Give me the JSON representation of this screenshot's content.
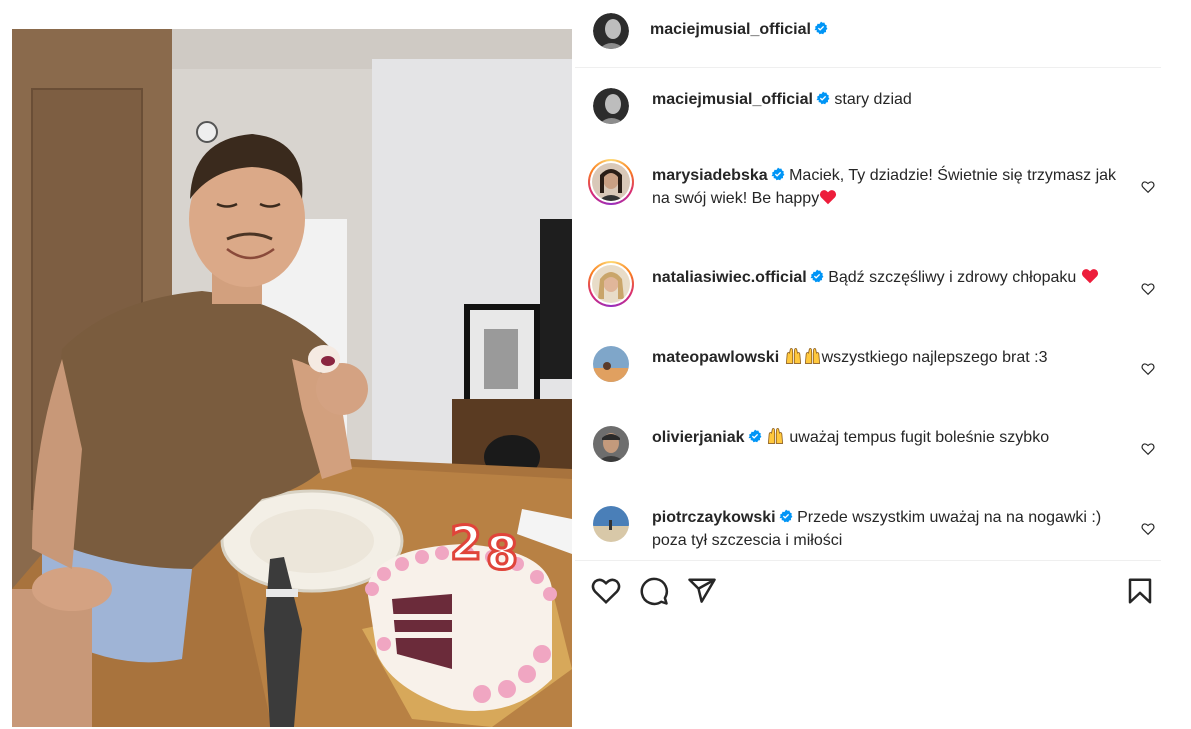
{
  "post": {
    "author": "maciejmusial_official",
    "caption_author": "maciejmusial_official",
    "caption_text": "stary dziad"
  },
  "comments": [
    {
      "username": "marysiadebska",
      "verified": true,
      "text": "Maciek, Ty dziadzie! Świetnie się trzymasz jak na swój wiek! Be happy",
      "emoji": "red-heart"
    },
    {
      "username": "nataliasiwiec.official",
      "verified": true,
      "text": "Bądź szczęśliwy i zdrowy chłopaku ",
      "emoji": "red-heart"
    },
    {
      "username": "mateopawlowski",
      "verified": false,
      "text": "wszystkiego najlepszego brat :3",
      "emoji": "raising-hands"
    },
    {
      "username": "olivierjaniak",
      "verified": true,
      "text": " uważaj tempus fugit boleśnie szybko",
      "emoji": "raising-hands"
    },
    {
      "username": "piotrczaykowski",
      "verified": true,
      "text": "Przede wszystkim uważaj na na nogawki :) poza tył szczescia i miłości"
    }
  ],
  "icons": {
    "like": "heart-outline-icon",
    "comment": "comment-bubble-icon",
    "share": "paper-plane-icon",
    "save": "bookmark-icon",
    "verified": "verified-badge-icon"
  },
  "colors": {
    "verified_blue": "#0095f6",
    "text": "#262626",
    "divider": "#efefef",
    "heart_red": "#ed1d3b"
  }
}
